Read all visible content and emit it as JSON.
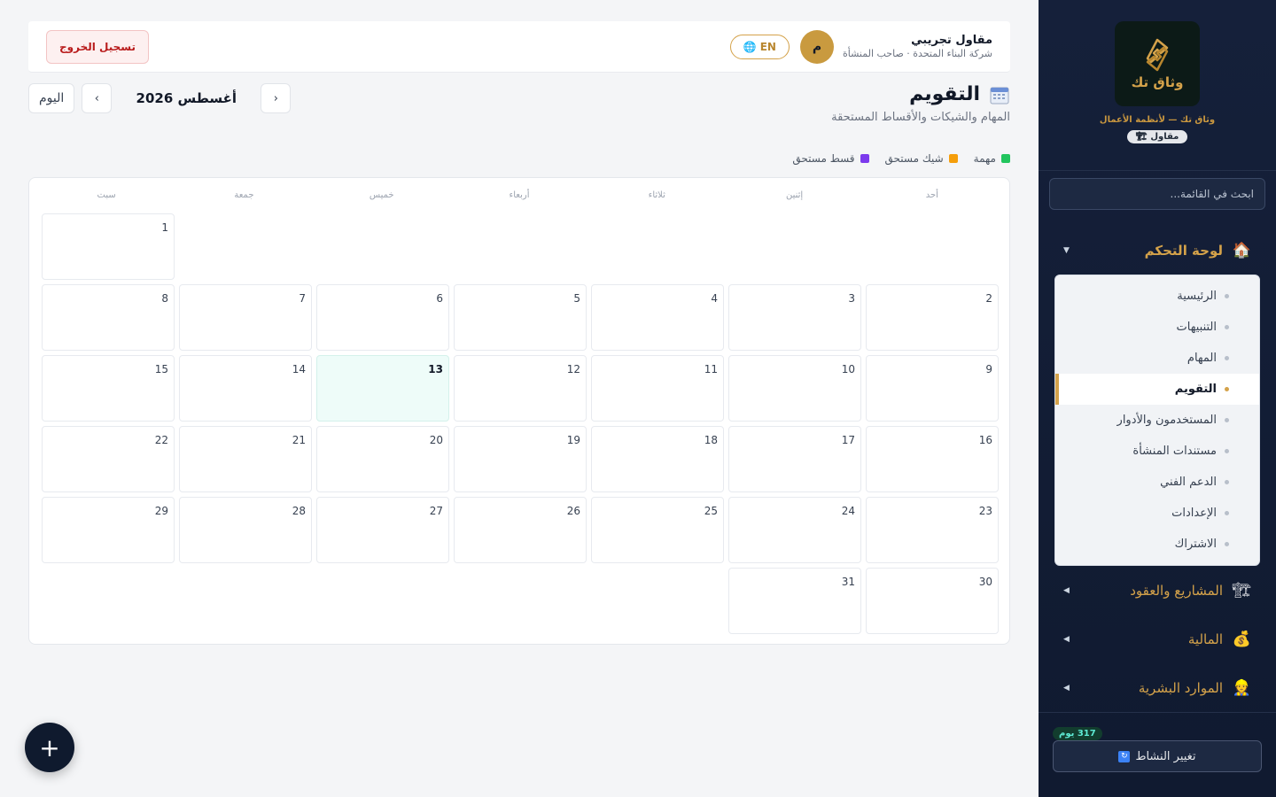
{
  "sidebar": {
    "logo_text": "وثاق تك",
    "tagline": "وثاق تك — لأنظمة الأعمال",
    "role_badge": "مقاول",
    "search_placeholder": "ابحث في القائمة...",
    "groups": [
      {
        "label": "لوحة التحكم",
        "icon": "house-icon",
        "expanded": true
      },
      {
        "label": "المشاريع والعقود",
        "icon": "crane-icon",
        "expanded": false
      },
      {
        "label": "المالية",
        "icon": "money-bag-icon",
        "expanded": false
      },
      {
        "label": "الموارد البشرية",
        "icon": "worker-icon",
        "expanded": false
      }
    ],
    "sub_items": [
      "الرئيسية",
      "التنبيهات",
      "المهام",
      "التقويم",
      "المستخدمون والأدوار",
      "مستندات المنشأة",
      "الدعم الفني",
      "الإعدادات",
      "الاشتراك"
    ],
    "active_sub_index": 3,
    "days_badge": "317 يوم",
    "switch_label": "تغيير النشاط"
  },
  "topbar": {
    "lang_label": "EN",
    "avatar_letter": "م",
    "user_name": "مقاول تجريبي",
    "user_org": "شركة البناء المتحدة · صاحب المنشأة",
    "logout_label": "تسجيل الخروج"
  },
  "page": {
    "title": "التقويم",
    "subtitle": "المهام والشيكات والأقساط المستحقة",
    "month_label": "أغسطس 2026",
    "prev_label": "‹",
    "next_label": "›",
    "today_label": "اليوم"
  },
  "legend": [
    {
      "label": "مهمة",
      "color": "#22c55e"
    },
    {
      "label": "شيك مستحق",
      "color": "#f59e0b"
    },
    {
      "label": "قسط مستحق",
      "color": "#7c3aed"
    }
  ],
  "calendar": {
    "weekdays": [
      "أحد",
      "إثنين",
      "ثلاثاء",
      "أربعاء",
      "خميس",
      "جمعة",
      "سبت"
    ],
    "first_weekday_index": 6,
    "days_in_month": 31,
    "today": 13
  },
  "colors": {
    "accent": "#d4a24a",
    "sidebar_bg": "#15203a",
    "today_bg": "#eefcf9"
  },
  "fab_label": "+"
}
